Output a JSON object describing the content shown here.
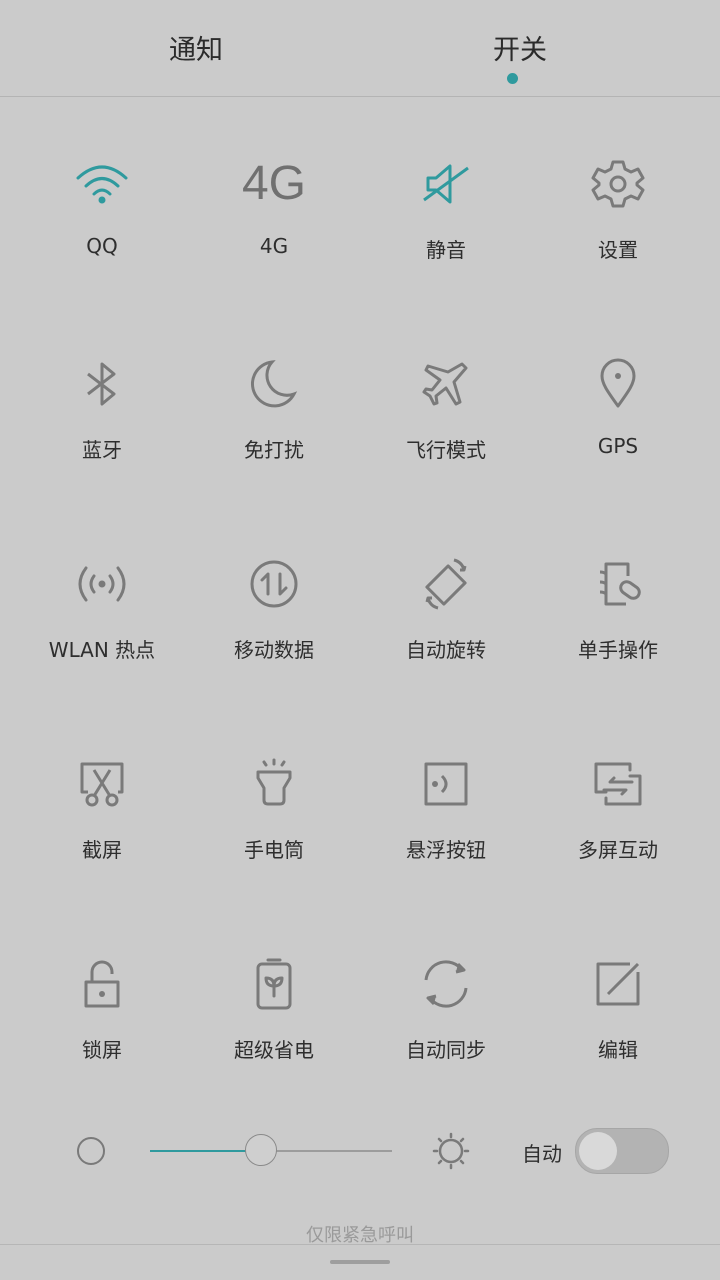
{
  "tabs": [
    {
      "label": "通知",
      "active": false
    },
    {
      "label": "开关",
      "active": true
    }
  ],
  "accent_color": "#2f9a9e",
  "tiles": [
    {
      "label": "QQ",
      "icon": "wifi-icon",
      "active": true
    },
    {
      "label": "4G",
      "icon": "4g-icon",
      "icon_text": "4G",
      "active": false
    },
    {
      "label": "静音",
      "icon": "mute-icon",
      "active": true
    },
    {
      "label": "设置",
      "icon": "gear-icon",
      "active": false
    },
    {
      "label": "蓝牙",
      "icon": "bluetooth-icon",
      "active": false
    },
    {
      "label": "免打扰",
      "icon": "moon-icon",
      "active": false
    },
    {
      "label": "飞行模式",
      "icon": "airplane-icon",
      "active": false
    },
    {
      "label": "GPS",
      "icon": "location-pin-icon",
      "active": false
    },
    {
      "label": "WLAN 热点",
      "icon": "hotspot-icon",
      "active": false
    },
    {
      "label": "移动数据",
      "icon": "mobile-data-icon",
      "active": false
    },
    {
      "label": "自动旋转",
      "icon": "rotate-icon",
      "active": false
    },
    {
      "label": "单手操作",
      "icon": "one-hand-icon",
      "active": false
    },
    {
      "label": "截屏",
      "icon": "screenshot-icon",
      "active": false
    },
    {
      "label": "手电筒",
      "icon": "flashlight-icon",
      "active": false
    },
    {
      "label": "悬浮按钮",
      "icon": "floating-button-icon",
      "active": false
    },
    {
      "label": "多屏互动",
      "icon": "multi-screen-icon",
      "active": false
    },
    {
      "label": "锁屏",
      "icon": "lock-icon",
      "active": false
    },
    {
      "label": "超级省电",
      "icon": "battery-saver-icon",
      "active": false
    },
    {
      "label": "自动同步",
      "icon": "sync-icon",
      "active": false
    },
    {
      "label": "编辑",
      "icon": "edit-icon",
      "active": false
    }
  ],
  "brightness": {
    "level_fraction": 0.46,
    "auto_label": "自动",
    "auto_enabled": false
  },
  "footer": {
    "emergency_text": "仅限紧急呼叫"
  }
}
